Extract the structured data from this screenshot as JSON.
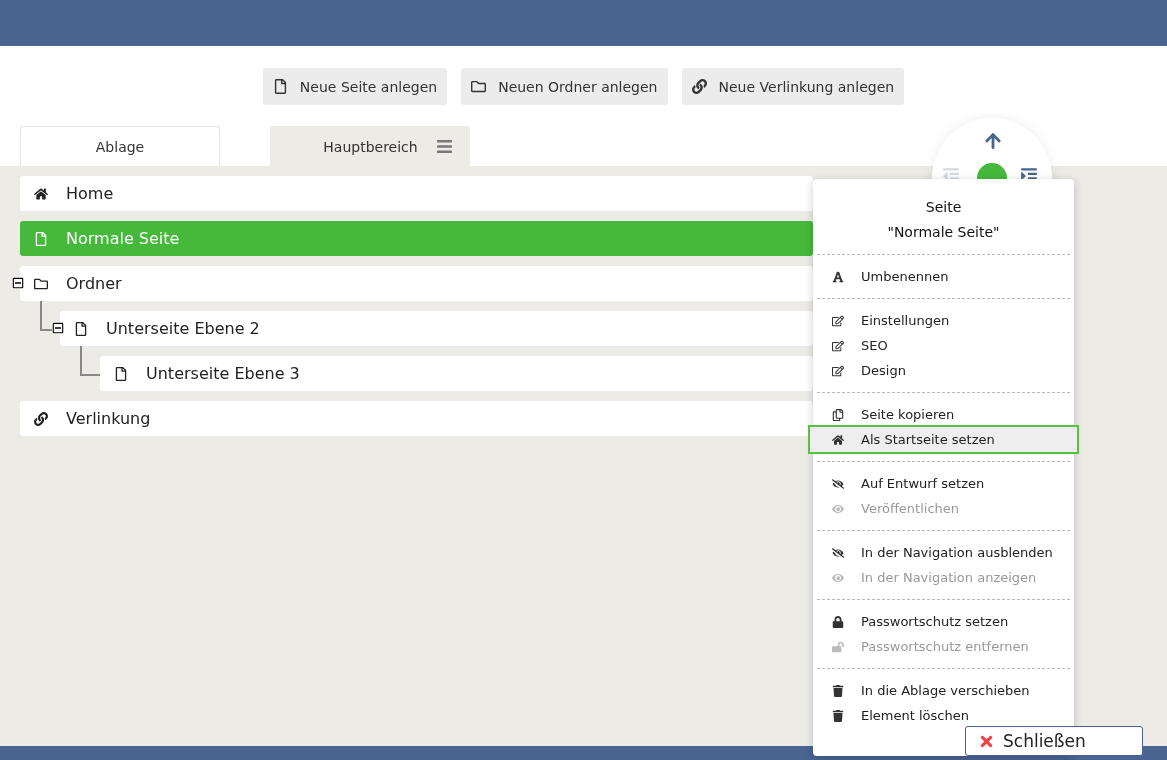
{
  "toolbar": [
    {
      "label": "Neue Seite anlegen",
      "kind": "page"
    },
    {
      "label": "Neuen Ordner anlegen",
      "kind": "folder"
    },
    {
      "label": "Neue Verlinkung anlegen",
      "kind": "link"
    }
  ],
  "tabs": [
    {
      "label": "Ablage",
      "selected": false,
      "kind": "plain"
    },
    {
      "label": "Hauptbereich",
      "selected": true,
      "kind": "menu"
    }
  ],
  "tree": [
    {
      "label": "Home",
      "kind": "home",
      "selected": false
    },
    {
      "label": "Normale Seite",
      "kind": "page",
      "selected": true
    },
    {
      "label": "Ordner",
      "kind": "folder",
      "selected": false,
      "expanded": true,
      "children": [
        {
          "label": "Unterseite Ebene 2",
          "kind": "page",
          "selected": false,
          "expanded": true,
          "children": [
            {
              "label": "Unterseite Ebene 3",
              "kind": "page",
              "selected": false
            }
          ]
        }
      ]
    },
    {
      "label": "Verlinkung",
      "kind": "link",
      "selected": false
    }
  ],
  "context_menu": {
    "title": "Seite",
    "subtitle": "\"Normale Seite\"",
    "sections": [
      [
        {
          "label": "Umbenennen",
          "kind": "rename",
          "disabled": false,
          "selected": false
        }
      ],
      [
        {
          "label": "Einstellungen",
          "kind": "edit",
          "disabled": false,
          "selected": false
        },
        {
          "label": "SEO",
          "kind": "edit",
          "disabled": false,
          "selected": false
        },
        {
          "label": "Design",
          "kind": "edit",
          "disabled": false,
          "selected": false
        }
      ],
      [
        {
          "label": "Seite kopieren",
          "kind": "copy",
          "disabled": false,
          "selected": false
        },
        {
          "label": "Als Startseite setzen",
          "kind": "home",
          "disabled": false,
          "selected": true
        }
      ],
      [
        {
          "label": "Auf Entwurf setzen",
          "kind": "hide",
          "disabled": false,
          "selected": false
        },
        {
          "label": "Veröffentlichen",
          "kind": "show",
          "disabled": true,
          "selected": false
        }
      ],
      [
        {
          "label": "In der Navigation ausblenden",
          "kind": "hide",
          "disabled": false,
          "selected": false
        },
        {
          "label": "In der Navigation anzeigen",
          "kind": "show",
          "disabled": true,
          "selected": false
        }
      ],
      [
        {
          "label": "Passwortschutz setzen",
          "kind": "lock",
          "disabled": false,
          "selected": false
        },
        {
          "label": "Passwortschutz entfernen",
          "kind": "unlock",
          "disabled": true,
          "selected": false
        }
      ],
      [
        {
          "label": "In die Ablage verschieben",
          "kind": "trash",
          "disabled": false,
          "selected": false
        },
        {
          "label": "Element löschen",
          "kind": "trash",
          "disabled": false,
          "selected": false
        }
      ]
    ]
  },
  "close_button": {
    "label": "Schließen"
  }
}
